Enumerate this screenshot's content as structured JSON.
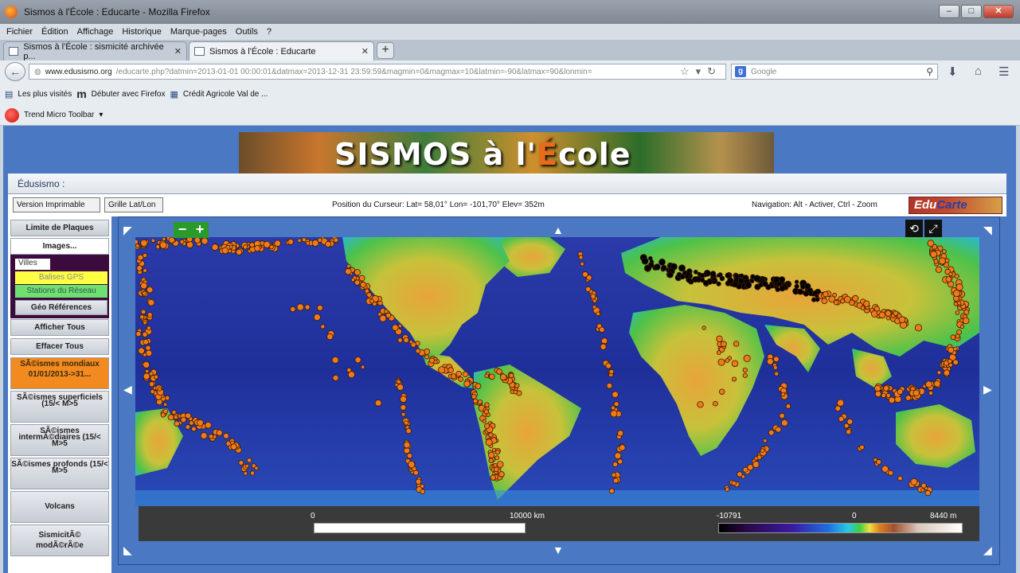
{
  "window": {
    "title": "Sismos à l'École : Educarte - Mozilla Firefox",
    "controls": [
      "–",
      "□",
      "✕"
    ]
  },
  "menu": [
    "Fichier",
    "Édition",
    "Affichage",
    "Historique",
    "Marque-pages",
    "Outils",
    "?"
  ],
  "tabs": [
    {
      "label": "Sismos à l'École : sismicité archivée p..."
    },
    {
      "label": "Sismos à l'École : Educarte"
    }
  ],
  "nav": {
    "url_domain": "www.edusismo.org",
    "url_rest": "/educarte.php?datmin=2013-01-01 00:00:01&datmax=2013-12-31 23:59:59&magmin=0&magmax=10&latmin=-90&latmax=90&lonmin=",
    "search_placeholder": "Google"
  },
  "bookmarks": [
    "Les plus visités",
    "Débuter avec Firefox",
    "Crédit Agricole Val de ..."
  ],
  "toolbar_trend": "Trend Micro Toolbar",
  "page": {
    "banner_pre": "SISMOS à l'",
    "banner_e": "É",
    "banner_post": "cole",
    "section": "Édusismo :",
    "btn_print": "Version Imprimable",
    "btn_grid": "Grille Lat/Lon",
    "cursor_pos": "Position du Curseur:  Lat= 58,01°  Lon= -101,70°  Elev= 352m",
    "nav_hint": "Navigation: Alt - Activer, Ctrl - Zoom",
    "logo_edu": "Edu",
    "logo_carte": "Carte"
  },
  "sidebar": {
    "plates": "Limite de Plaques",
    "images": "Images...",
    "villes": "Villes",
    "gps": "Balises GPS",
    "stations": "Stations du Réseau",
    "georef": "Géo Références",
    "show_all": "Afficher Tous",
    "clear_all": "Effacer Tous",
    "world_quakes": "SÃ©ismes mondiaux 01/01/2013->31...",
    "shallow": "SÃ©ismes superficiels (15/< M>5",
    "intermediate": "SÃ©ismes intermÃ©diaires (15/< M>5",
    "deep": "SÃ©ismes profonds (15/< M>5",
    "volcans": "Volcans",
    "moderate_1": "SismicitÃ©",
    "moderate_2": "modÃ©rÃ©e"
  },
  "scale": {
    "dist_start": "0",
    "dist_end": "10000 km",
    "elev_min": "-10791",
    "elev_zero": "0",
    "elev_max": "8440 m"
  },
  "colors": {
    "page_bg": "#4a78c2",
    "quake_orange": "#f07a1a",
    "quake_black": "#000000"
  }
}
